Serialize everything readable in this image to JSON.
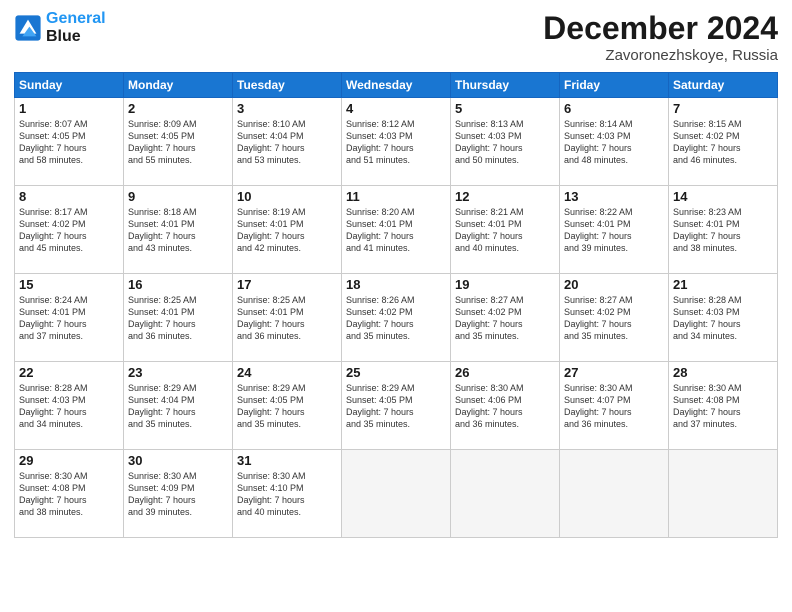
{
  "header": {
    "logo_line1": "General",
    "logo_line2": "Blue",
    "month": "December 2024",
    "location": "Zavoronezhskoye, Russia"
  },
  "weekdays": [
    "Sunday",
    "Monday",
    "Tuesday",
    "Wednesday",
    "Thursday",
    "Friday",
    "Saturday"
  ],
  "weeks": [
    [
      {
        "day": "1",
        "info": "Sunrise: 8:07 AM\nSunset: 4:05 PM\nDaylight: 7 hours\nand 58 minutes."
      },
      {
        "day": "2",
        "info": "Sunrise: 8:09 AM\nSunset: 4:05 PM\nDaylight: 7 hours\nand 55 minutes."
      },
      {
        "day": "3",
        "info": "Sunrise: 8:10 AM\nSunset: 4:04 PM\nDaylight: 7 hours\nand 53 minutes."
      },
      {
        "day": "4",
        "info": "Sunrise: 8:12 AM\nSunset: 4:03 PM\nDaylight: 7 hours\nand 51 minutes."
      },
      {
        "day": "5",
        "info": "Sunrise: 8:13 AM\nSunset: 4:03 PM\nDaylight: 7 hours\nand 50 minutes."
      },
      {
        "day": "6",
        "info": "Sunrise: 8:14 AM\nSunset: 4:03 PM\nDaylight: 7 hours\nand 48 minutes."
      },
      {
        "day": "7",
        "info": "Sunrise: 8:15 AM\nSunset: 4:02 PM\nDaylight: 7 hours\nand 46 minutes."
      }
    ],
    [
      {
        "day": "8",
        "info": "Sunrise: 8:17 AM\nSunset: 4:02 PM\nDaylight: 7 hours\nand 45 minutes."
      },
      {
        "day": "9",
        "info": "Sunrise: 8:18 AM\nSunset: 4:01 PM\nDaylight: 7 hours\nand 43 minutes."
      },
      {
        "day": "10",
        "info": "Sunrise: 8:19 AM\nSunset: 4:01 PM\nDaylight: 7 hours\nand 42 minutes."
      },
      {
        "day": "11",
        "info": "Sunrise: 8:20 AM\nSunset: 4:01 PM\nDaylight: 7 hours\nand 41 minutes."
      },
      {
        "day": "12",
        "info": "Sunrise: 8:21 AM\nSunset: 4:01 PM\nDaylight: 7 hours\nand 40 minutes."
      },
      {
        "day": "13",
        "info": "Sunrise: 8:22 AM\nSunset: 4:01 PM\nDaylight: 7 hours\nand 39 minutes."
      },
      {
        "day": "14",
        "info": "Sunrise: 8:23 AM\nSunset: 4:01 PM\nDaylight: 7 hours\nand 38 minutes."
      }
    ],
    [
      {
        "day": "15",
        "info": "Sunrise: 8:24 AM\nSunset: 4:01 PM\nDaylight: 7 hours\nand 37 minutes."
      },
      {
        "day": "16",
        "info": "Sunrise: 8:25 AM\nSunset: 4:01 PM\nDaylight: 7 hours\nand 36 minutes."
      },
      {
        "day": "17",
        "info": "Sunrise: 8:25 AM\nSunset: 4:01 PM\nDaylight: 7 hours\nand 36 minutes."
      },
      {
        "day": "18",
        "info": "Sunrise: 8:26 AM\nSunset: 4:02 PM\nDaylight: 7 hours\nand 35 minutes."
      },
      {
        "day": "19",
        "info": "Sunrise: 8:27 AM\nSunset: 4:02 PM\nDaylight: 7 hours\nand 35 minutes."
      },
      {
        "day": "20",
        "info": "Sunrise: 8:27 AM\nSunset: 4:02 PM\nDaylight: 7 hours\nand 35 minutes."
      },
      {
        "day": "21",
        "info": "Sunrise: 8:28 AM\nSunset: 4:03 PM\nDaylight: 7 hours\nand 34 minutes."
      }
    ],
    [
      {
        "day": "22",
        "info": "Sunrise: 8:28 AM\nSunset: 4:03 PM\nDaylight: 7 hours\nand 34 minutes."
      },
      {
        "day": "23",
        "info": "Sunrise: 8:29 AM\nSunset: 4:04 PM\nDaylight: 7 hours\nand 35 minutes."
      },
      {
        "day": "24",
        "info": "Sunrise: 8:29 AM\nSunset: 4:05 PM\nDaylight: 7 hours\nand 35 minutes."
      },
      {
        "day": "25",
        "info": "Sunrise: 8:29 AM\nSunset: 4:05 PM\nDaylight: 7 hours\nand 35 minutes."
      },
      {
        "day": "26",
        "info": "Sunrise: 8:30 AM\nSunset: 4:06 PM\nDaylight: 7 hours\nand 36 minutes."
      },
      {
        "day": "27",
        "info": "Sunrise: 8:30 AM\nSunset: 4:07 PM\nDaylight: 7 hours\nand 36 minutes."
      },
      {
        "day": "28",
        "info": "Sunrise: 8:30 AM\nSunset: 4:08 PM\nDaylight: 7 hours\nand 37 minutes."
      }
    ],
    [
      {
        "day": "29",
        "info": "Sunrise: 8:30 AM\nSunset: 4:08 PM\nDaylight: 7 hours\nand 38 minutes."
      },
      {
        "day": "30",
        "info": "Sunrise: 8:30 AM\nSunset: 4:09 PM\nDaylight: 7 hours\nand 39 minutes."
      },
      {
        "day": "31",
        "info": "Sunrise: 8:30 AM\nSunset: 4:10 PM\nDaylight: 7 hours\nand 40 minutes."
      },
      null,
      null,
      null,
      null
    ]
  ]
}
